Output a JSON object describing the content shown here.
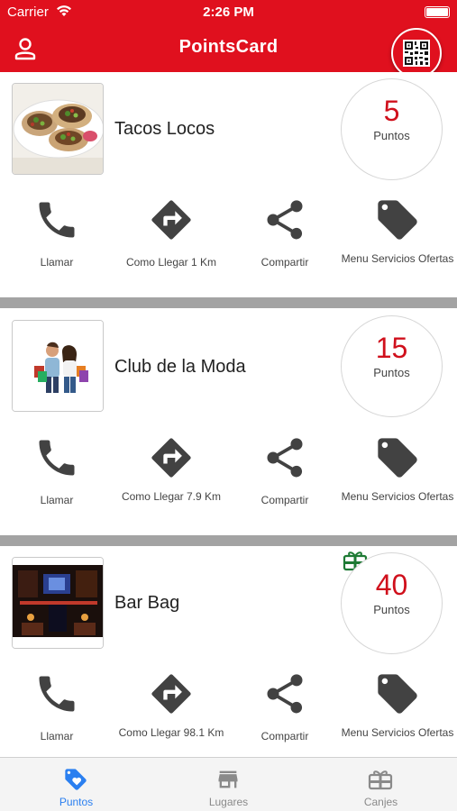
{
  "status_bar": {
    "carrier": "Carrier",
    "time": "2:26 PM",
    "icons": [
      "wifi-icon",
      "battery-icon"
    ]
  },
  "nav": {
    "title": "PointsCard",
    "left_icon": "user-icon",
    "right_icon": "qr-code-icon"
  },
  "colors": {
    "brand_red": "#e0101e",
    "points_red": "#d0101c",
    "icon_gray": "#424242",
    "separator_gray": "#a3a3a3",
    "tab_active": "#2a7ff0",
    "tab_inactive": "#8a8a8a",
    "gift_green": "#1e7a34"
  },
  "cards": [
    {
      "name": "Tacos Locos",
      "points": "5",
      "points_label": "Puntos",
      "image": "tacos-photo",
      "has_gift_badge": false,
      "actions": {
        "call": "Llamar",
        "directions": "Como Llegar 1 Km",
        "share": "Compartir",
        "menu": "Menu  Servicios Ofertas"
      }
    },
    {
      "name": "Club de la Moda",
      "points": "15",
      "points_label": "Puntos",
      "image": "shopping-couple-photo",
      "has_gift_badge": false,
      "actions": {
        "call": "Llamar",
        "directions": "Como Llegar 7.9 Km",
        "share": "Compartir",
        "menu": "Menu  Servicios Ofertas"
      }
    },
    {
      "name": "Bar Bag",
      "points": "40",
      "points_label": "Puntos",
      "image": "bar-night-photo",
      "has_gift_badge": true,
      "actions": {
        "call": "Llamar",
        "directions": "Como Llegar 98.1 Km",
        "share": "Compartir",
        "menu": "Menu  Servicios Ofertas"
      }
    }
  ],
  "tabs": [
    {
      "label": "Puntos",
      "icon": "tag-icon",
      "active": true
    },
    {
      "label": "Lugares",
      "icon": "store-icon",
      "active": false
    },
    {
      "label": "Canjes",
      "icon": "gift-card-icon",
      "active": false
    }
  ]
}
